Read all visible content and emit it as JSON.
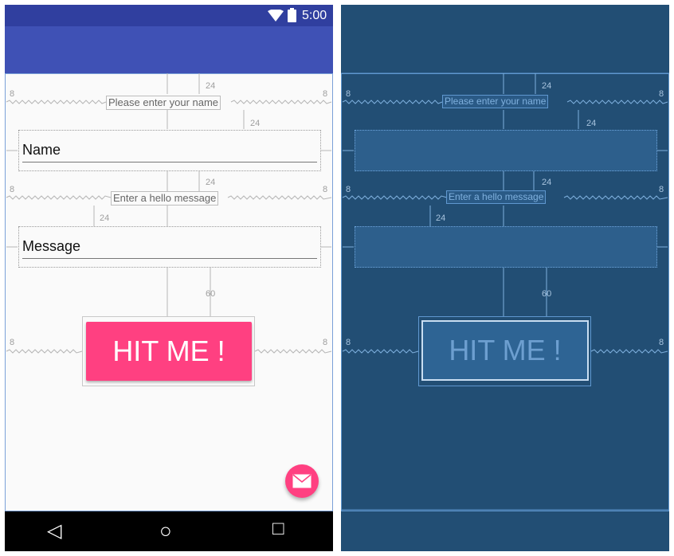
{
  "status_bar": {
    "time": "5:00"
  },
  "form": {
    "name_hint": "Please enter your name",
    "name_value": "Name",
    "message_hint": "Enter a hello message",
    "message_value": "Message",
    "button_label": "HIT ME !"
  },
  "constraints": {
    "margin_side": "8",
    "margin_24": "24",
    "margin_60": "60"
  },
  "nav": {
    "back": "◁",
    "home": "○",
    "recents": "□"
  },
  "colors": {
    "primary": "#3f51b5",
    "primary_dark": "#303f9f",
    "accent": "#ff4081",
    "blueprint_bg": "#224e74"
  }
}
